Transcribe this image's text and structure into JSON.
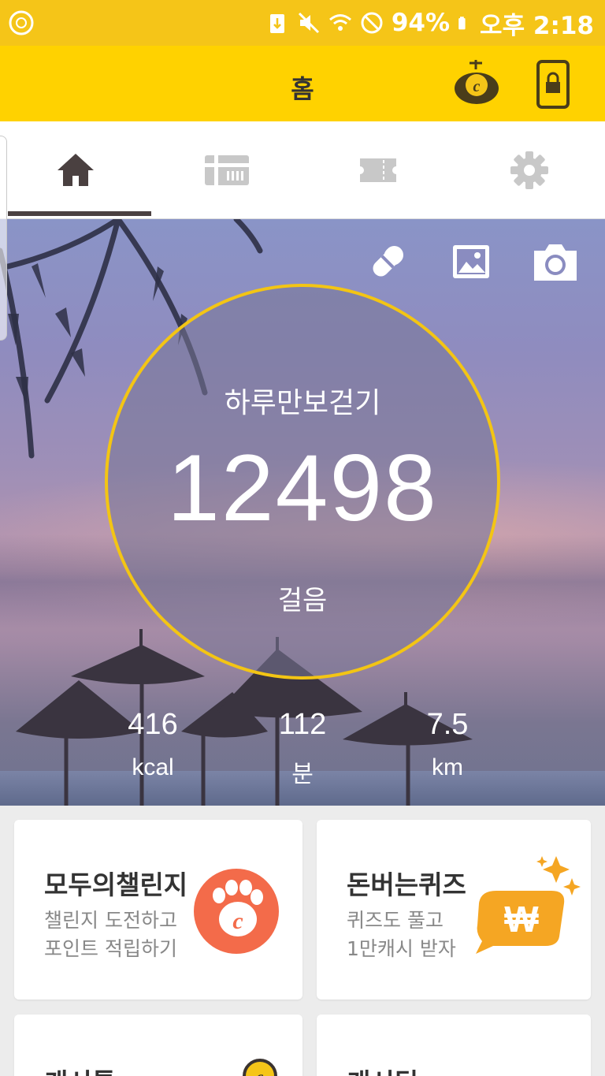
{
  "status_bar": {
    "battery_percent": "94%",
    "time": "오후 2:18",
    "icons": [
      "app-icon",
      "usb-icon",
      "mute-icon",
      "wifi-icon",
      "blocked-icon",
      "battery-icon"
    ]
  },
  "app_bar": {
    "title": "홈",
    "icons": [
      "cash-coin-icon",
      "phone-lock-icon"
    ]
  },
  "tabs": [
    {
      "icon": "home-icon",
      "active": true
    },
    {
      "icon": "gift-card-icon",
      "active": false
    },
    {
      "icon": "ticket-icon",
      "active": false
    },
    {
      "icon": "gear-icon",
      "active": false
    }
  ],
  "hero": {
    "actions": [
      "pill-icon",
      "gallery-icon",
      "camera-icon"
    ],
    "label": "하루만보걷기",
    "step_count": "12498",
    "step_unit": "걸음",
    "stats": [
      {
        "value": "416",
        "unit": "kcal"
      },
      {
        "value": "112",
        "unit": "분"
      },
      {
        "value": "7.5",
        "unit": "km"
      }
    ]
  },
  "cards": [
    {
      "title": "모두의챌린지",
      "line1": "챌린지 도전하고",
      "line2": "포인트 적립하기",
      "icon": "paw-icon"
    },
    {
      "title": "돈버는퀴즈",
      "line1": "퀴즈도 풀고",
      "line2": "1만캐시 받자",
      "icon": "won-sparkle-icon"
    },
    {
      "title": "캐시톡",
      "icon": "coin-icon"
    },
    {
      "title": "캐시딜"
    }
  ],
  "colors": {
    "status_bar": "#f5c518",
    "app_bar": "#ffd200",
    "ring": "#f3c514",
    "paw_circle": "#f36b4a",
    "won_badge": "#f5a623"
  }
}
